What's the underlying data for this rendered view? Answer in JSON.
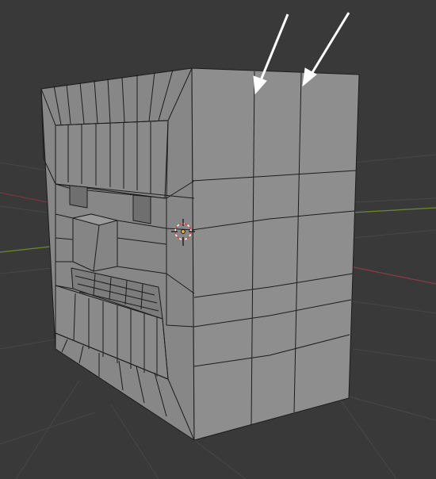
{
  "viewport": {
    "background": "#393939",
    "grid_color": "#4a4a4a",
    "axis_x_color": "#8a3b45",
    "axis_y_color": "#6b8a2e",
    "mesh_front_color": "#8e8e8e",
    "mesh_side_color": "#878787",
    "mesh_edge_color": "#1c1c1c",
    "arrow_color": "#ffffff",
    "cursor_color": "#e0453a",
    "origin_color": "#f0a23a"
  },
  "annotations": {
    "arrow_count": 2
  },
  "icons": {
    "cursor": "3d-cursor-icon",
    "origin": "object-origin-icon",
    "arrows": "pointer-arrow-icon"
  }
}
